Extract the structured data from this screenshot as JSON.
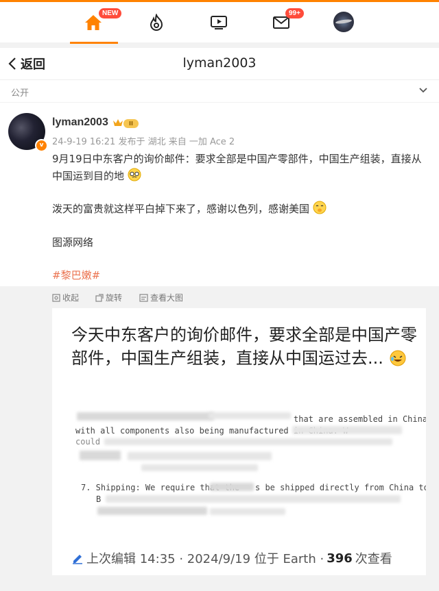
{
  "nav": {
    "home_badge": "NEW",
    "mail_badge": "99+"
  },
  "header": {
    "back_label": "返回",
    "title": "lyman2003"
  },
  "visibility": {
    "label": "公开"
  },
  "post": {
    "username": "lyman2003",
    "level": "II",
    "meta": "24-9-19 16:21 发布于 湖北 来自 一加 Ace 2",
    "para1": "9月19日中东客户的询价邮件：要求全部是中国产零部件，中国生产组装，直接从中国运到目的地",
    "para2": "泼天的富贵就这样平白掉下来了，感谢以色列，感谢美国",
    "para3": "图源网络",
    "hashtag": "#黎巴嫩#"
  },
  "actions": {
    "collect": "收起",
    "rotate": "旋转",
    "view_large": "查看大图"
  },
  "image": {
    "title": "今天中东客户的询价邮件，要求全部是中国产零部件，中国生产组装，直接从中国运过去...",
    "line1_tail": "that are assembled in China",
    "line2": "with all components also being manufactured in China. W",
    "line3": "could",
    "line4_a": "7. Shipping: We require that the",
    "line4_b": "s be shipped directly from China to",
    "line5": "B",
    "footer_prefix": "上次编辑 14:35 · 2024/9/19 位于 Earth ·",
    "footer_views": "396",
    "footer_suffix": "次查看"
  },
  "colors": {
    "accent": "#ff8200",
    "hashtag": "#eb7350",
    "badge": "#ff4c3b"
  }
}
